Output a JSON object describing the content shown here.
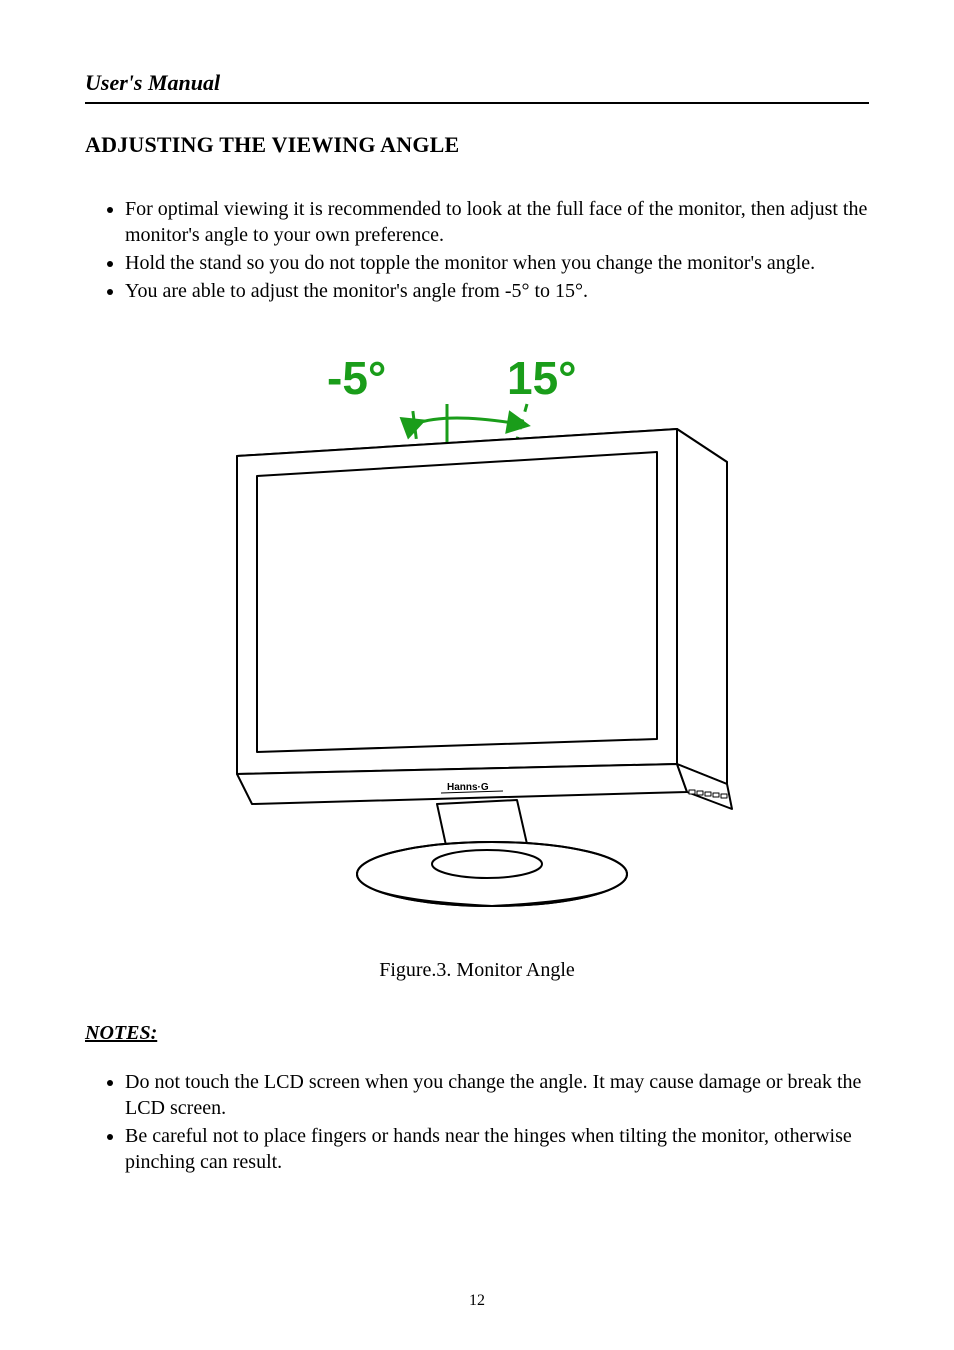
{
  "header": "User's Manual",
  "section_title": "ADJUSTING THE VIEWING ANGLE",
  "bullets": [
    "For optimal viewing it is recommended to look at the full face of the monitor, then adjust the monitor's angle to your own preference.",
    "Hold the stand so you do not topple the monitor when you change the monitor's angle.",
    "You are able to adjust the monitor's angle from -5° to 15°."
  ],
  "figure": {
    "angle_left": "-5°",
    "angle_right": "15°",
    "brand": "Hanns·G",
    "caption": "Figure.3. Monitor Angle"
  },
  "notes_title": "NOTES:",
  "notes": [
    "Do not touch the LCD screen when you change the angle. It may cause damage or break the LCD screen.",
    "Be careful not to place fingers or hands near the hinges when tilting the monitor, otherwise pinching can result."
  ],
  "page_number": "12"
}
